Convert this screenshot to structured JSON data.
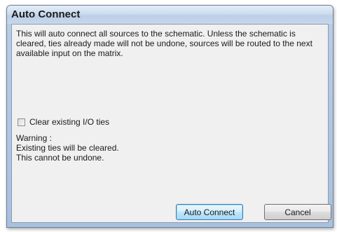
{
  "window": {
    "title": "Auto Connect"
  },
  "dialog": {
    "description": "This will auto connect all sources to the schematic.  Unless the schematic is cleared, ties already made will not be undone, sources will be routed to the next available input on the matrix.",
    "checkbox": {
      "label": "Clear existing I/O ties",
      "checked": false
    },
    "warning": {
      "heading": "Warning :",
      "line1": "Existing ties will be cleared.",
      "line2": "This cannot be undone."
    }
  },
  "buttons": {
    "auto_connect": "Auto Connect",
    "cancel": "Cancel"
  }
}
